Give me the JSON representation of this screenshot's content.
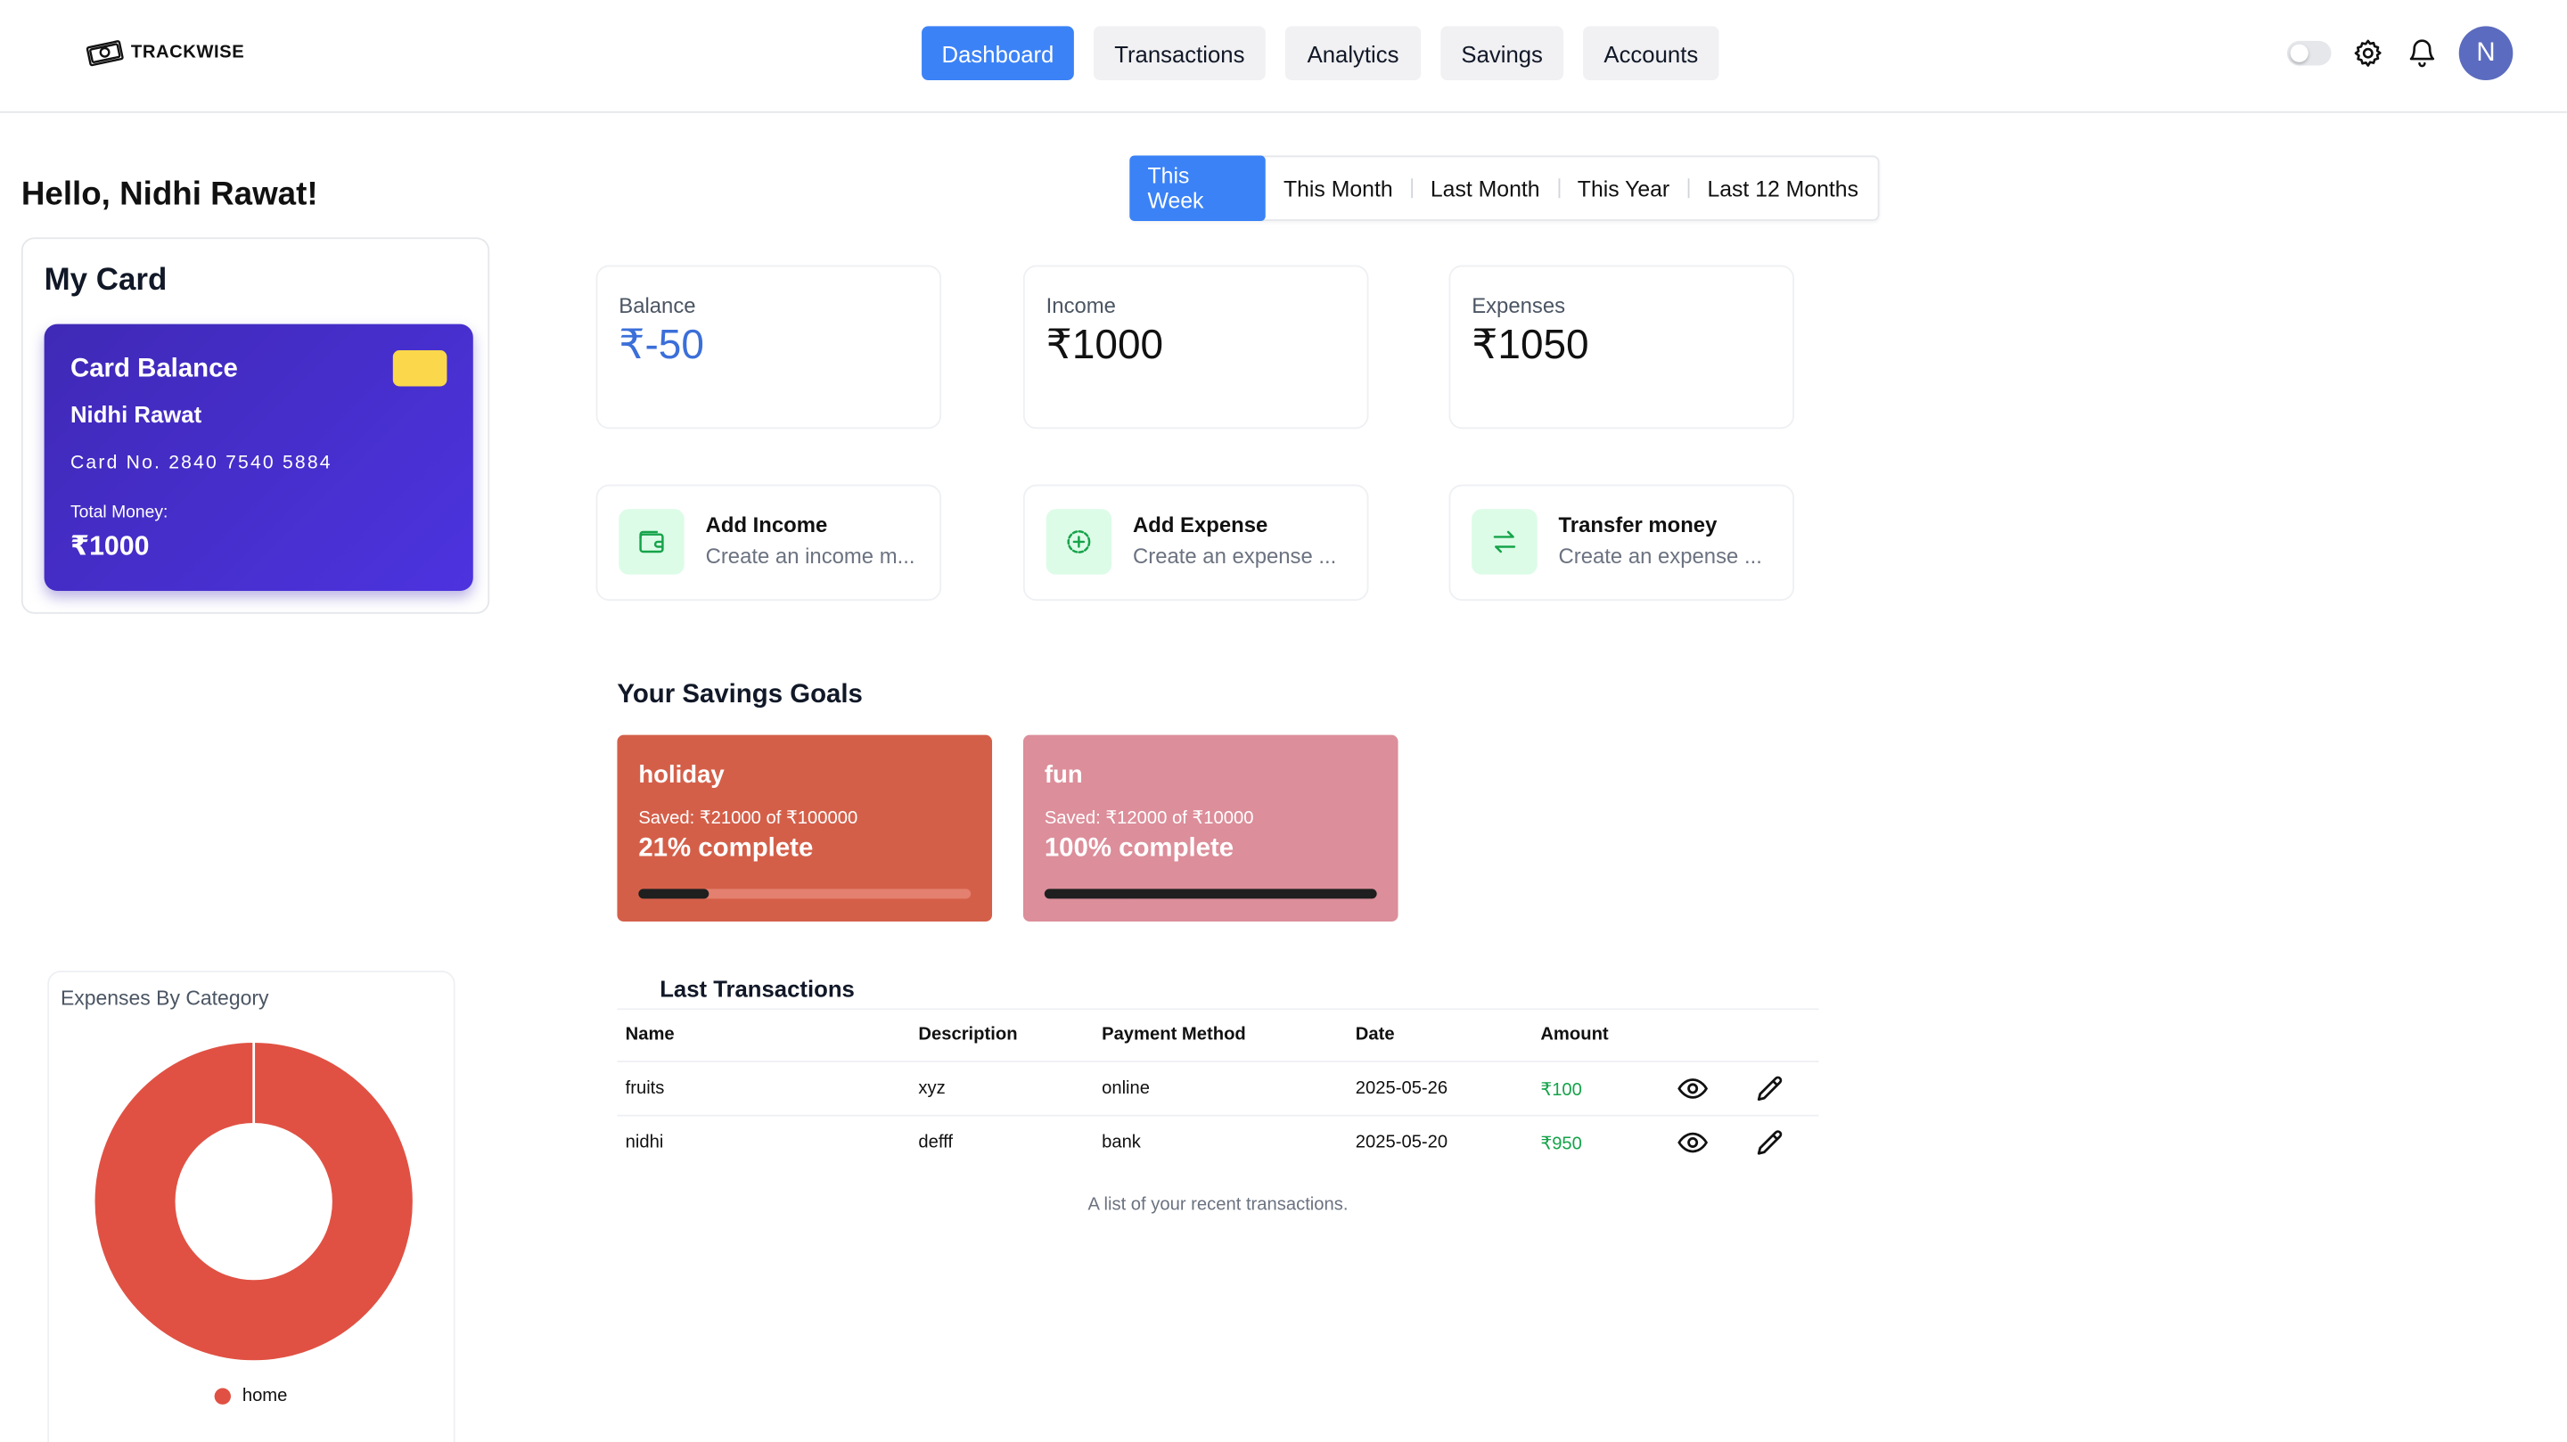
{
  "brand": {
    "name": "TRACKWISE"
  },
  "nav": [
    {
      "label": "Dashboard",
      "active": true
    },
    {
      "label": "Transactions",
      "active": false
    },
    {
      "label": "Analytics",
      "active": false
    },
    {
      "label": "Savings",
      "active": false
    },
    {
      "label": "Accounts",
      "active": false
    }
  ],
  "header": {
    "avatar_initial": "N",
    "theme_toggle_on": false
  },
  "greeting": "Hello, Nidhi Rawat!",
  "periods": [
    {
      "label": "This Week",
      "active": true
    },
    {
      "label": "This Month",
      "active": false
    },
    {
      "label": "Last Month",
      "active": false
    },
    {
      "label": "This Year",
      "active": false
    },
    {
      "label": "Last 12 Months",
      "active": false
    }
  ],
  "my_card": {
    "title": "My Card",
    "card_balance_label": "Card Balance",
    "holder": "Nidhi Rawat",
    "card_number": "Card No. 2840 7540 5884",
    "total_label": "Total Money:",
    "total_value": "₹1000"
  },
  "stats": [
    {
      "label": "Balance",
      "value": "₹-50",
      "color": "#3b6fd9"
    },
    {
      "label": "Income",
      "value": "₹1000",
      "color": "#111111"
    },
    {
      "label": "Expenses",
      "value": "₹1050",
      "color": "#111111"
    }
  ],
  "actions": [
    {
      "title": "Add Income",
      "subtitle": "Create an income m...",
      "icon": "wallet-icon"
    },
    {
      "title": "Add Expense",
      "subtitle": "Create an expense ...",
      "icon": "circle-plus-icon"
    },
    {
      "title": "Transfer money",
      "subtitle": "Create an expense ...",
      "icon": "transfer-arrows-icon"
    }
  ],
  "savings": {
    "title": "Your Savings Goals",
    "goals": [
      {
        "name": "holiday",
        "saved": "Saved: ₹21000 of ₹100000",
        "percent_text": "21% complete",
        "progress": 0.21,
        "bg": "#d45f49",
        "track": "#e4806f"
      },
      {
        "name": "fun",
        "saved": "Saved: ₹12000 of ₹10000",
        "percent_text": "100% complete",
        "progress": 1.0,
        "bg": "#dc8e9a",
        "track": "#e7aab3"
      }
    ]
  },
  "transactions": {
    "title": "Last Transactions",
    "columns": [
      "Name",
      "Description",
      "Payment Method",
      "Date",
      "Amount"
    ],
    "rows": [
      {
        "name": "fruits",
        "description": "xyz",
        "method": "online",
        "date": "2025-05-26",
        "amount": "₹100"
      },
      {
        "name": "nidhi",
        "description": "defff",
        "method": "bank",
        "date": "2025-05-20",
        "amount": "₹950"
      }
    ],
    "caption": "A list of your recent transactions."
  },
  "expenses_chart": {
    "title": "Expenses By Category"
  },
  "chart_data": {
    "type": "pie",
    "title": "Expenses By Category",
    "categories": [
      "home"
    ],
    "values": [
      1050
    ],
    "colors": [
      "#e05143"
    ],
    "donut": true,
    "legend": "bottom"
  }
}
